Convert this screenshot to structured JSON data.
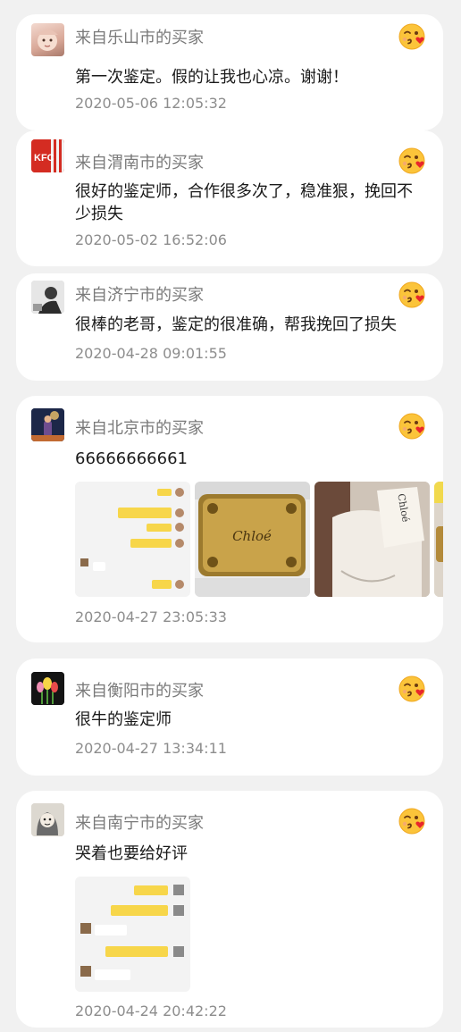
{
  "reviews": [
    {
      "buyer": "来自乐山市的买家",
      "comment": "第一次鉴定。假的让我也心凉。谢谢！",
      "time": "2020-05-06 12:05:32",
      "avatar": "baby-avatar",
      "emoji": "kiss-face-icon"
    },
    {
      "buyer": "来自渭南市的买家",
      "comment": "很好的鉴定师，合作很多次了，稳准狠，挽回不少损失",
      "time": "2020-05-02 16:52:06",
      "avatar": "kfc-avatar",
      "emoji": "kiss-face-icon"
    },
    {
      "buyer": "来自济宁市的买家",
      "comment": "很棒的老哥，鉴定的很准确，帮我挽回了损失",
      "time": "2020-04-28 09:01:55",
      "avatar": "bw-photo-avatar",
      "emoji": "kiss-face-icon"
    },
    {
      "buyer": "来自北京市的买家",
      "comment": "66666666661",
      "time": "2020-04-27 23:05:33",
      "avatar": "night-photo-avatar",
      "emoji": "kiss-face-icon",
      "photos": [
        {
          "name": "chat-screenshot",
          "brand": ""
        },
        {
          "name": "chloe-plate-photo",
          "brand": "Chloé"
        },
        {
          "name": "chloe-bag-tag-photo",
          "brand": "Chloé"
        },
        {
          "name": "bag-partial-photo",
          "brand": ""
        }
      ]
    },
    {
      "buyer": "来自衡阳市的买家",
      "comment": "很牛的鉴定师",
      "time": "2020-04-27 13:34:11",
      "avatar": "tulip-avatar",
      "emoji": "kiss-face-icon"
    },
    {
      "buyer": "来自南宁市的买家",
      "comment": "哭着也要给好评",
      "time": "2020-04-24 20:42:22",
      "avatar": "cartoon-avatar",
      "emoji": "kiss-face-icon",
      "photos": [
        {
          "name": "chat-screenshot",
          "brand": ""
        }
      ]
    }
  ],
  "colors": {
    "page_bg": "#f1f1f1",
    "card_bg": "#ffffff",
    "meta_text": "#8d8d8d",
    "chat_bubble": "#f7d64a"
  }
}
